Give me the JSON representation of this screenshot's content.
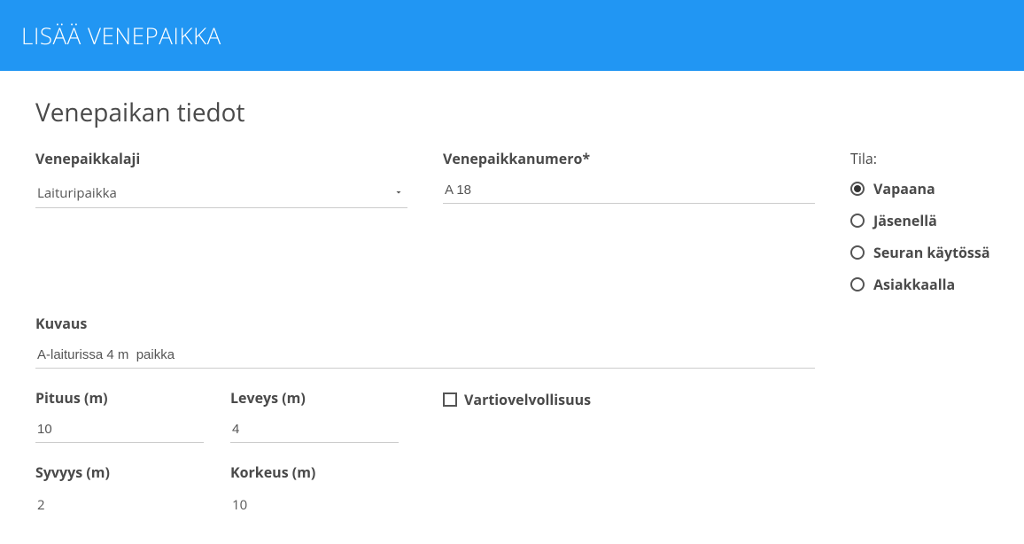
{
  "header": {
    "title": "LISÄÄ VENEPAIKKA"
  },
  "section": {
    "title": "Venepaikan tiedot"
  },
  "fields": {
    "type_label": "Venepaikkalaji",
    "type_value": "Laituripaikka",
    "number_label": "Venepaikkanumero*",
    "number_value": "A 18",
    "description_label": "Kuvaus",
    "description_value": "A-laiturissa 4 m  paikka",
    "length_label": "Pituus (m)",
    "length_value": "10",
    "width_label": "Leveys (m)",
    "width_value": "4",
    "depth_label": "Syvyys (m)",
    "depth_value": "2",
    "height_label": "Korkeus (m)",
    "height_value": "10",
    "guard_label": "Vartiovelvollisuus",
    "guard_checked": false
  },
  "status": {
    "title": "Tila:",
    "options": [
      {
        "label": "Vapaana",
        "checked": true
      },
      {
        "label": "Jäsenellä",
        "checked": false
      },
      {
        "label": "Seuran käytössä",
        "checked": false
      },
      {
        "label": "Asiakkaalla",
        "checked": false
      }
    ]
  }
}
